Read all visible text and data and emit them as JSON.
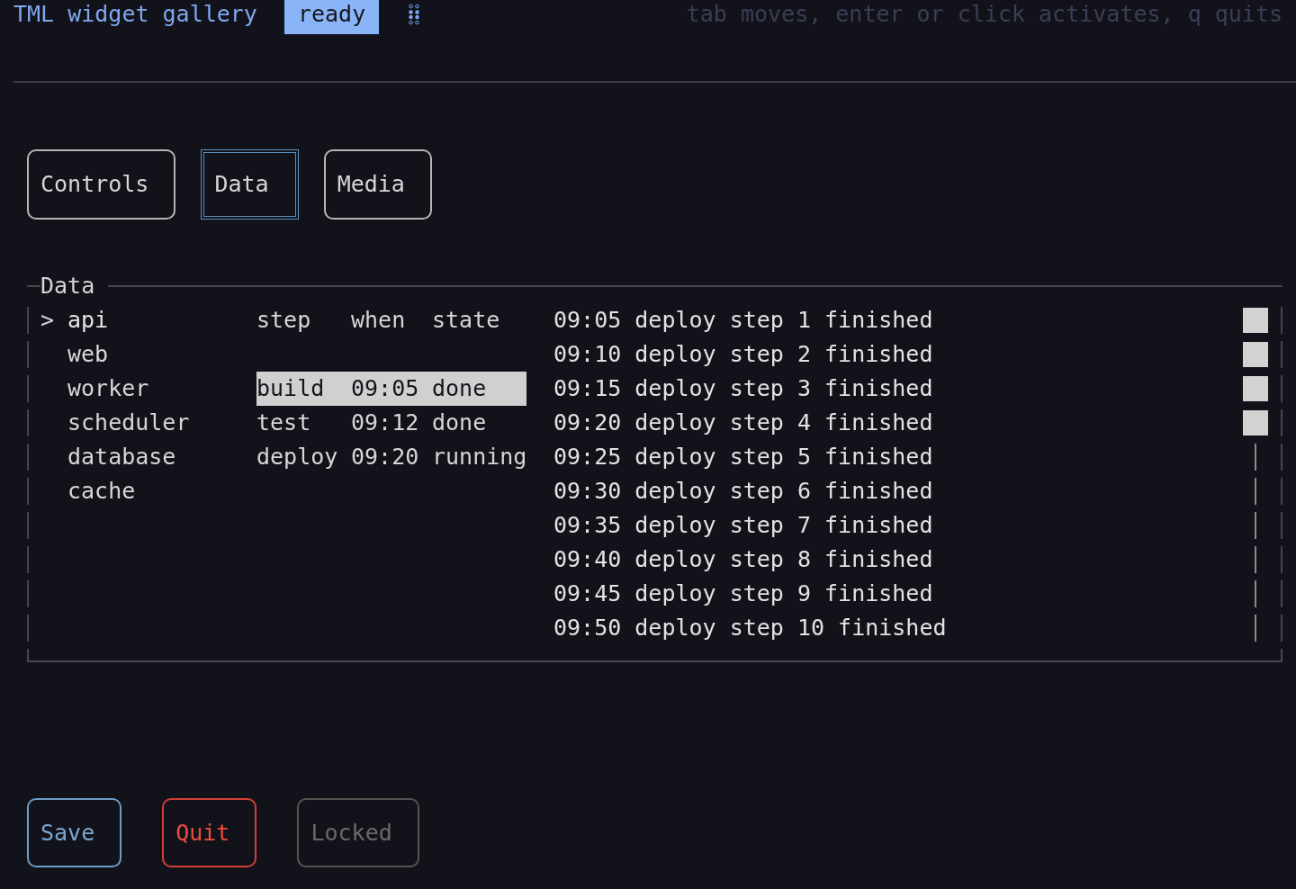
{
  "header": {
    "title": "TML widget gallery",
    "status": "ready",
    "hint": "tab moves, enter or click activates, q quits"
  },
  "tabs": [
    {
      "label": "Controls",
      "selected": false
    },
    {
      "label": "Data",
      "selected": true
    },
    {
      "label": "Media",
      "selected": false
    }
  ],
  "data_panel": {
    "title": "Data",
    "list": {
      "marker": ">",
      "items": [
        {
          "label": "api",
          "selected": true
        },
        {
          "label": "web",
          "selected": false
        },
        {
          "label": "worker",
          "selected": false
        },
        {
          "label": "scheduler",
          "selected": false
        },
        {
          "label": "database",
          "selected": false
        },
        {
          "label": "cache",
          "selected": false
        }
      ]
    },
    "table": {
      "columns": [
        "step",
        "when",
        "state"
      ],
      "rows": [
        {
          "cells": [
            "build",
            "09:05",
            "done"
          ],
          "selected": true
        },
        {
          "cells": [
            "test",
            "09:12",
            "done"
          ],
          "selected": false
        },
        {
          "cells": [
            "deploy",
            "09:20",
            "running"
          ],
          "selected": false
        }
      ]
    },
    "log": {
      "lines": [
        "09:05 deploy step 1 finished",
        "09:10 deploy step 2 finished",
        "09:15 deploy step 3 finished",
        "09:20 deploy step 4 finished",
        "09:25 deploy step 5 finished",
        "09:30 deploy step 6 finished",
        "09:35 deploy step 7 finished",
        "09:40 deploy step 8 finished",
        "09:45 deploy step 9 finished",
        "09:50 deploy step 10 finished"
      ]
    }
  },
  "buttons": [
    {
      "label": "Save",
      "kind": "primary",
      "disabled": false
    },
    {
      "label": "Quit",
      "kind": "danger",
      "disabled": false
    },
    {
      "label": "Locked",
      "kind": "default",
      "disabled": true
    }
  ]
}
